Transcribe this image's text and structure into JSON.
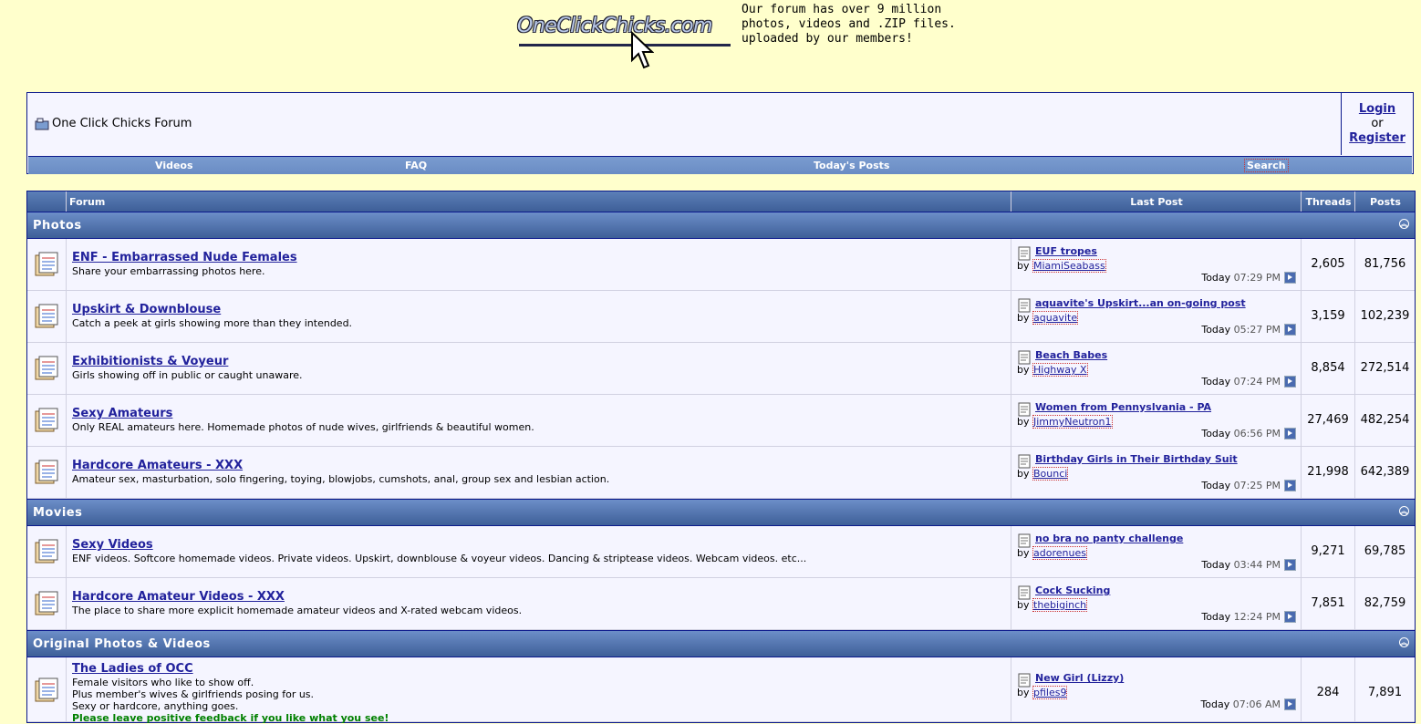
{
  "header": {
    "logo_text": "OneClickChicks.com",
    "tagline": [
      "Our forum has over 9 million",
      "photos, videos and .ZIP files.",
      "uploaded by our members!"
    ]
  },
  "nav": {
    "site_title": "One Click Chicks Forum",
    "login": "Login",
    "or": "or",
    "register": "Register",
    "links": [
      "Videos",
      "FAQ",
      "Today's Posts",
      "Search"
    ]
  },
  "table": {
    "headers": {
      "forum": "Forum",
      "last_post": "Last Post",
      "threads": "Threads",
      "posts": "Posts"
    },
    "categories": [
      {
        "name": "Photos",
        "forums": [
          {
            "name": "ENF - Embarrassed Nude Females",
            "desc": [
              "Share your embarrassing photos here."
            ],
            "lp_title": "EUF tropes",
            "lp_by": "MiamiSeabass",
            "lp_day": "Today",
            "lp_time": "07:29 PM",
            "threads": "2,605",
            "posts": "81,756"
          },
          {
            "name": "Upskirt & Downblouse",
            "desc": [
              "Catch a peek at girls showing more than they intended."
            ],
            "lp_title": "aquavite's Upskirt...an on-going post",
            "lp_by": "aquavite",
            "lp_day": "Today",
            "lp_time": "05:27 PM",
            "threads": "3,159",
            "posts": "102,239"
          },
          {
            "name": "Exhibitionists & Voyeur",
            "desc": [
              "Girls showing off in public or caught unaware."
            ],
            "lp_title": "Beach Babes",
            "lp_by": "Highway X",
            "lp_day": "Today",
            "lp_time": "07:24 PM",
            "threads": "8,854",
            "posts": "272,514"
          },
          {
            "name": "Sexy Amateurs",
            "desc": [
              "Only REAL amateurs here. Homemade photos of nude wives, girlfriends & beautiful women."
            ],
            "lp_title": "Women from Pennyslvania - PA",
            "lp_by": "JimmyNeutron1",
            "lp_day": "Today",
            "lp_time": "06:56 PM",
            "threads": "27,469",
            "posts": "482,254"
          },
          {
            "name": "Hardcore Amateurs - XXX",
            "desc": [
              "Amateur sex, masturbation, solo fingering, toying, blowjobs, cumshots, anal, group sex and lesbian action."
            ],
            "lp_title": "Birthday Girls in Their Birthday Suit",
            "lp_by": "Bounci",
            "lp_day": "Today",
            "lp_time": "07:25 PM",
            "threads": "21,998",
            "posts": "642,389"
          }
        ]
      },
      {
        "name": "Movies",
        "forums": [
          {
            "name": "Sexy Videos",
            "desc": [
              "ENF videos. Softcore homemade videos. Private videos. Upskirt, downblouse & voyeur videos. Dancing & striptease videos. Webcam videos. etc..."
            ],
            "lp_title": "no bra no panty challenge",
            "lp_by": "adorenues",
            "lp_day": "Today",
            "lp_time": "03:44 PM",
            "threads": "9,271",
            "posts": "69,785"
          },
          {
            "name": "Hardcore Amateur Videos - XXX",
            "desc": [
              "The place to share more explicit homemade amateur videos and X-rated webcam videos."
            ],
            "lp_title": "Cock Sucking",
            "lp_by": "thebiginch",
            "lp_day": "Today",
            "lp_time": "12:24 PM",
            "threads": "7,851",
            "posts": "82,759"
          }
        ]
      },
      {
        "name": "Original Photos & Videos",
        "forums": [
          {
            "name": "The Ladies of OCC",
            "desc": [
              "Female visitors who like to show off.",
              "Plus member's wives & girlfriends posing for us.",
              "Sexy or hardcore, anything goes."
            ],
            "desc_green": "Please leave positive feedback if you like what you see!",
            "lp_title": "New Girl (Lizzy)",
            "lp_by": "pfiles9",
            "lp_day": "Today",
            "lp_time": "07:06 AM",
            "threads": "284",
            "posts": "7,891"
          }
        ]
      }
    ],
    "lp_by_prefix": "by"
  }
}
